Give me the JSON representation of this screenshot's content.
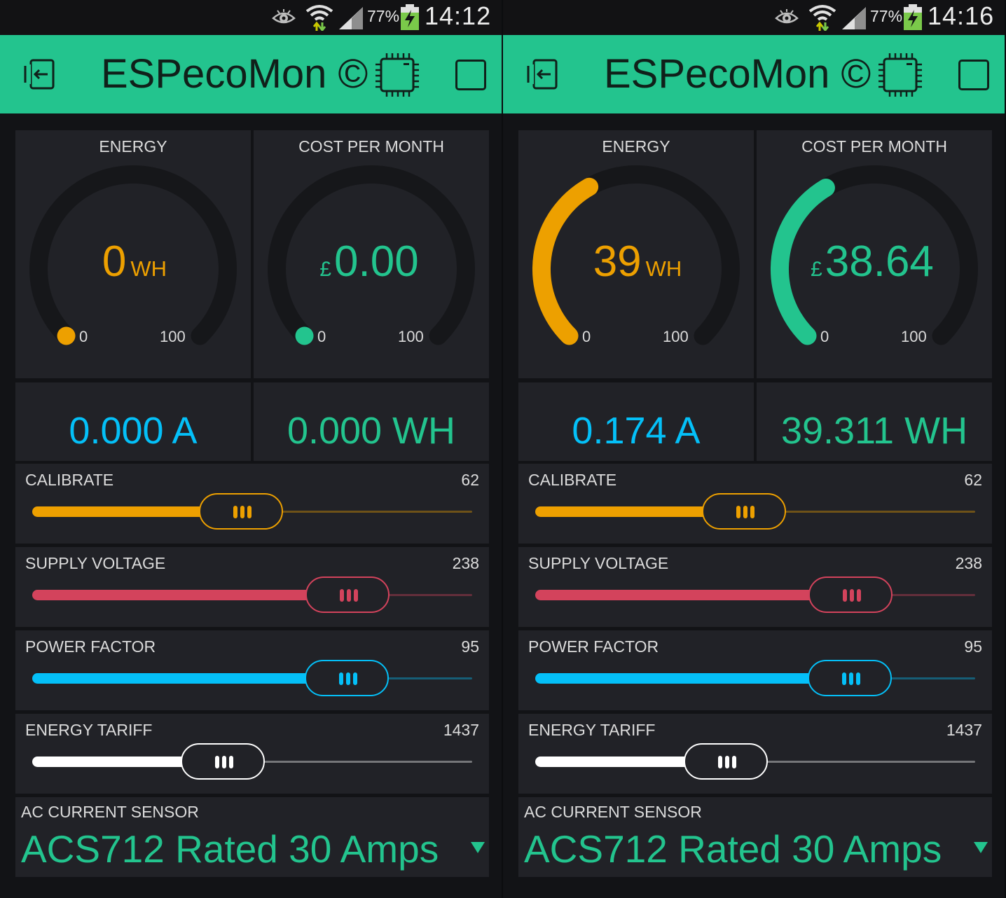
{
  "colors": {
    "header": "#23c48e",
    "energy": "#eda000",
    "cost": "#23c48e",
    "current": "#04c0f8",
    "energy_display": "#23c48e",
    "calibrate": "#eda000",
    "supply_voltage": "#d3435c",
    "power_factor": "#04c0f8",
    "energy_tariff": "#ffffff",
    "gauge_track": "#16171a"
  },
  "icons": {
    "status": [
      "eye-icon",
      "wifi-icon",
      "signal-icon",
      "battery-charging-icon"
    ],
    "header": [
      "logout-icon",
      "device-chip-icon",
      "square-icon"
    ],
    "dropdown": "caret-down-icon"
  },
  "screens": [
    {
      "status": {
        "battery": "77%",
        "time": "14:12"
      },
      "header": {
        "title": "ESPecoMon ©"
      },
      "gauges": [
        {
          "label": "ENERGY",
          "prefix": "",
          "value": "0",
          "unit": "WH",
          "min": "0",
          "max": "100",
          "fraction": 0
        },
        {
          "label": "COST PER MONTH",
          "prefix": "£",
          "value": "0.00",
          "unit": "",
          "min": "0",
          "max": "100",
          "fraction": 0
        }
      ],
      "displays": [
        {
          "value": "0.000 A"
        },
        {
          "value": "0.000 WH"
        }
      ],
      "sliders": [
        {
          "label": "CALIBRATE",
          "value": "62",
          "fraction": 0.465
        },
        {
          "label": "SUPPLY VOLTAGE",
          "value": "238",
          "fraction": 0.763
        },
        {
          "label": "POWER FACTOR",
          "value": "95",
          "fraction": 0.761
        },
        {
          "label": "ENERGY TARIFF",
          "value": "1437",
          "fraction": 0.414
        }
      ],
      "dropdown": {
        "label": "AC CURRENT SENSOR",
        "value": "ACS712 Rated 30 Amps"
      }
    },
    {
      "status": {
        "battery": "77%",
        "time": "14:16"
      },
      "header": {
        "title": "ESPecoMon ©"
      },
      "gauges": [
        {
          "label": "ENERGY",
          "prefix": "",
          "value": "39",
          "unit": "WH",
          "min": "0",
          "max": "100",
          "fraction": 0.39
        },
        {
          "label": "COST PER MONTH",
          "prefix": "£",
          "value": "38.64",
          "unit": "",
          "min": "0",
          "max": "100",
          "fraction": 0.386
        }
      ],
      "displays": [
        {
          "value": "0.174 A"
        },
        {
          "value": "39.311 WH"
        }
      ],
      "sliders": [
        {
          "label": "CALIBRATE",
          "value": "62",
          "fraction": 0.465
        },
        {
          "label": "SUPPLY VOLTAGE",
          "value": "238",
          "fraction": 0.763
        },
        {
          "label": "POWER FACTOR",
          "value": "95",
          "fraction": 0.761
        },
        {
          "label": "ENERGY TARIFF",
          "value": "1437",
          "fraction": 0.414
        }
      ],
      "dropdown": {
        "label": "AC CURRENT SENSOR",
        "value": "ACS712 Rated 30 Amps"
      }
    }
  ]
}
